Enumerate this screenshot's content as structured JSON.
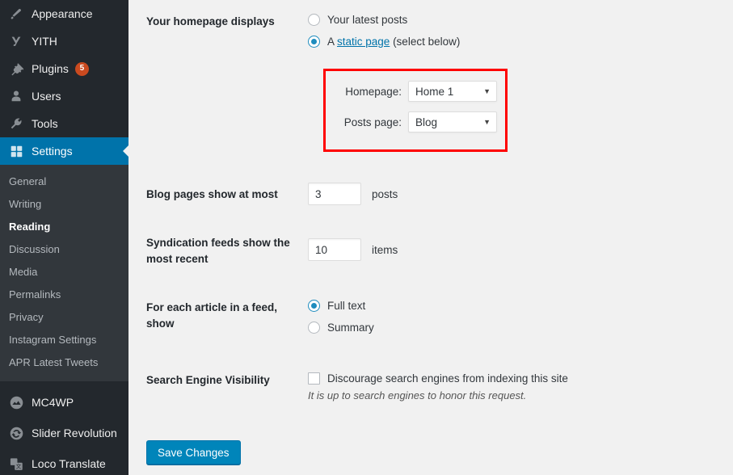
{
  "sidebar": {
    "top_items": [
      {
        "label": "Appearance",
        "icon": "paintbrush-icon",
        "badge": null
      },
      {
        "label": "YITH",
        "icon": "yith-logo-icon",
        "badge": null
      },
      {
        "label": "Plugins",
        "icon": "plug-icon",
        "badge": "5"
      },
      {
        "label": "Users",
        "icon": "user-icon",
        "badge": null
      },
      {
        "label": "Tools",
        "icon": "wrench-icon",
        "badge": null
      },
      {
        "label": "Settings",
        "icon": "settings-sliders-icon",
        "badge": null
      }
    ],
    "submenu": [
      {
        "label": "General",
        "current": false
      },
      {
        "label": "Writing",
        "current": false
      },
      {
        "label": "Reading",
        "current": true
      },
      {
        "label": "Discussion",
        "current": false
      },
      {
        "label": "Media",
        "current": false
      },
      {
        "label": "Permalinks",
        "current": false
      },
      {
        "label": "Privacy",
        "current": false
      },
      {
        "label": "Instagram Settings",
        "current": false
      },
      {
        "label": "APR Latest Tweets",
        "current": false
      }
    ],
    "bottom_items": [
      {
        "label": "MC4WP",
        "icon": "mc4wp-icon"
      },
      {
        "label": "Slider Revolution",
        "icon": "slider-revolution-icon"
      },
      {
        "label": "Loco Translate",
        "icon": "loco-translate-icon"
      }
    ],
    "colors": {
      "background": "#23282d",
      "submenu_background": "#32373c",
      "active_item": "#0073aa",
      "badge": "#ca4a1f"
    }
  },
  "main": {
    "homepage_display": {
      "label": "Your homepage displays",
      "option_latest_posts": "Your latest posts",
      "option_static_prefix": "A ",
      "option_static_link": "static page",
      "option_static_suffix": " (select below)",
      "selected": "static_page",
      "highlight_color": "#ff0000",
      "homepage_label": "Homepage:",
      "homepage_value": "Home 1",
      "posts_page_label": "Posts page:",
      "posts_page_value": "Blog"
    },
    "blog_pages": {
      "label": "Blog pages show at most",
      "value": "3",
      "unit": "posts"
    },
    "syndication": {
      "label": "Syndication feeds show the most recent",
      "value": "10",
      "unit": "items"
    },
    "feed_article": {
      "label": "For each article in a feed, show",
      "option_full_text": "Full text",
      "option_summary": "Summary",
      "selected": "full_text"
    },
    "search_visibility": {
      "label": "Search Engine Visibility",
      "checkbox_label": "Discourage search engines from indexing this site",
      "checked": false,
      "note": "It is up to search engines to honor this request."
    },
    "save_button": "Save Changes"
  }
}
